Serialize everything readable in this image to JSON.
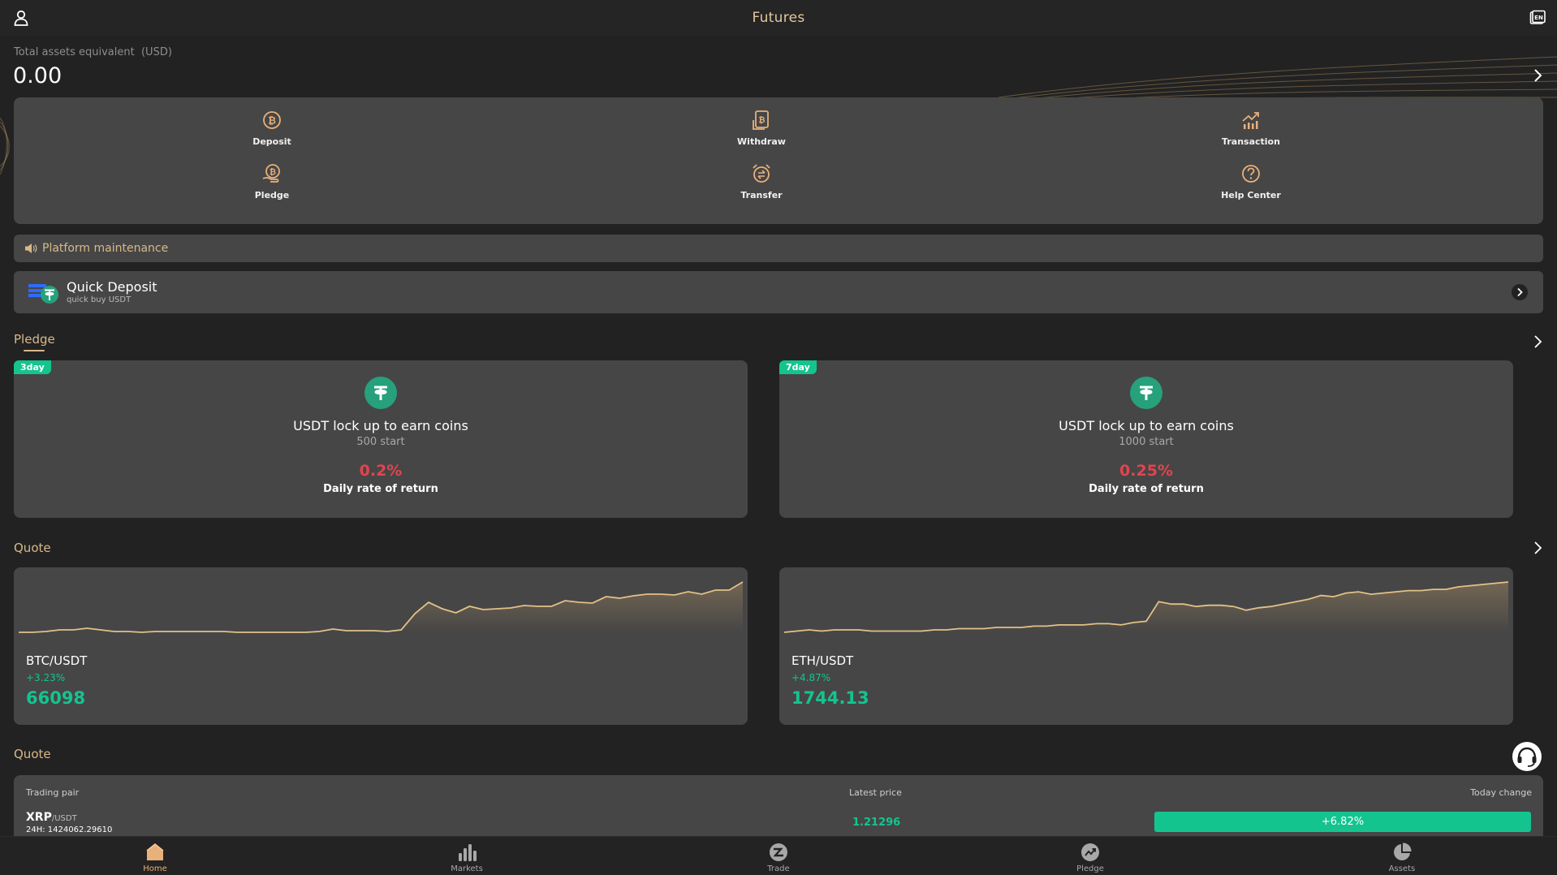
{
  "header": {
    "title": "Futures"
  },
  "assets": {
    "label": "Total assets equivalent  (USD)",
    "value": "0.00"
  },
  "actions": [
    {
      "label": "Deposit",
      "icon": "deposit-icon"
    },
    {
      "label": "Withdraw",
      "icon": "withdraw-icon"
    },
    {
      "label": "Transaction",
      "icon": "transaction-icon"
    },
    {
      "label": "Pledge",
      "icon": "pledge-icon"
    },
    {
      "label": "Transfer",
      "icon": "transfer-icon"
    },
    {
      "label": "Help Center",
      "icon": "help-icon"
    }
  ],
  "notice": {
    "text": "Platform maintenance"
  },
  "quick_deposit": {
    "title": "Quick Deposit",
    "subtitle": "quick buy USDT"
  },
  "pledge": {
    "title": "Pledge",
    "cards": [
      {
        "tag": "3day",
        "title": "USDT lock up to earn coins",
        "start": "500 start",
        "rate": "0.2%",
        "rate_label": "Daily rate of return"
      },
      {
        "tag": "7day",
        "title": "USDT lock up to earn coins",
        "start": "1000 start",
        "rate": "0.25%",
        "rate_label": "Daily rate of return"
      }
    ]
  },
  "quote": {
    "title": "Quote",
    "cards": [
      {
        "pair": "BTC/USDT",
        "change": "+3.23%",
        "price": "66098",
        "spark": [
          3,
          3,
          4,
          6,
          6,
          8,
          6,
          4,
          4,
          3,
          4,
          4,
          4,
          4,
          4,
          4,
          3,
          3,
          3,
          3,
          3,
          3,
          4,
          7,
          5,
          5,
          5,
          4,
          6,
          26,
          40,
          32,
          27,
          35,
          31,
          32,
          33,
          36,
          35,
          35,
          42,
          40,
          39,
          47,
          45,
          48,
          50,
          50,
          49,
          53,
          50,
          55,
          55,
          65
        ]
      },
      {
        "pair": "ETH/USDT",
        "change": "+4.87%",
        "price": "1744.13",
        "spark": [
          3,
          4,
          5,
          4,
          5,
          5,
          5,
          4,
          4,
          4,
          4,
          4,
          5,
          5,
          6,
          6,
          6,
          7,
          7,
          7,
          8,
          8,
          9,
          9,
          9,
          10,
          10,
          9,
          11,
          12,
          28,
          26,
          26,
          24,
          25,
          25,
          24,
          21,
          23,
          24,
          26,
          28,
          30,
          33,
          32,
          35,
          36,
          34,
          35,
          36,
          37,
          37,
          38,
          38,
          40,
          41,
          42,
          43,
          44
        ]
      }
    ]
  },
  "market_list": {
    "title": "Quote",
    "headers": {
      "pair": "Trading pair",
      "price": "Latest price",
      "change": "Today change"
    },
    "rows": [
      {
        "base": "XRP",
        "quote": "/USDT",
        "volume": "24H: 1424062.29610",
        "price": "1.21296",
        "change": "+6.82%"
      }
    ]
  },
  "tabs": [
    {
      "label": "Home",
      "icon": "home-icon"
    },
    {
      "label": "Markets",
      "icon": "markets-icon"
    },
    {
      "label": "Trade",
      "icon": "trade-icon"
    },
    {
      "label": "Pledge",
      "icon": "pledge-tab-icon"
    },
    {
      "label": "Assets",
      "icon": "assets-icon"
    }
  ],
  "colors": {
    "accent": "#d8b98a",
    "up": "#14c48f",
    "down": "#e0454f",
    "panel": "#464646",
    "background": "#222222"
  }
}
